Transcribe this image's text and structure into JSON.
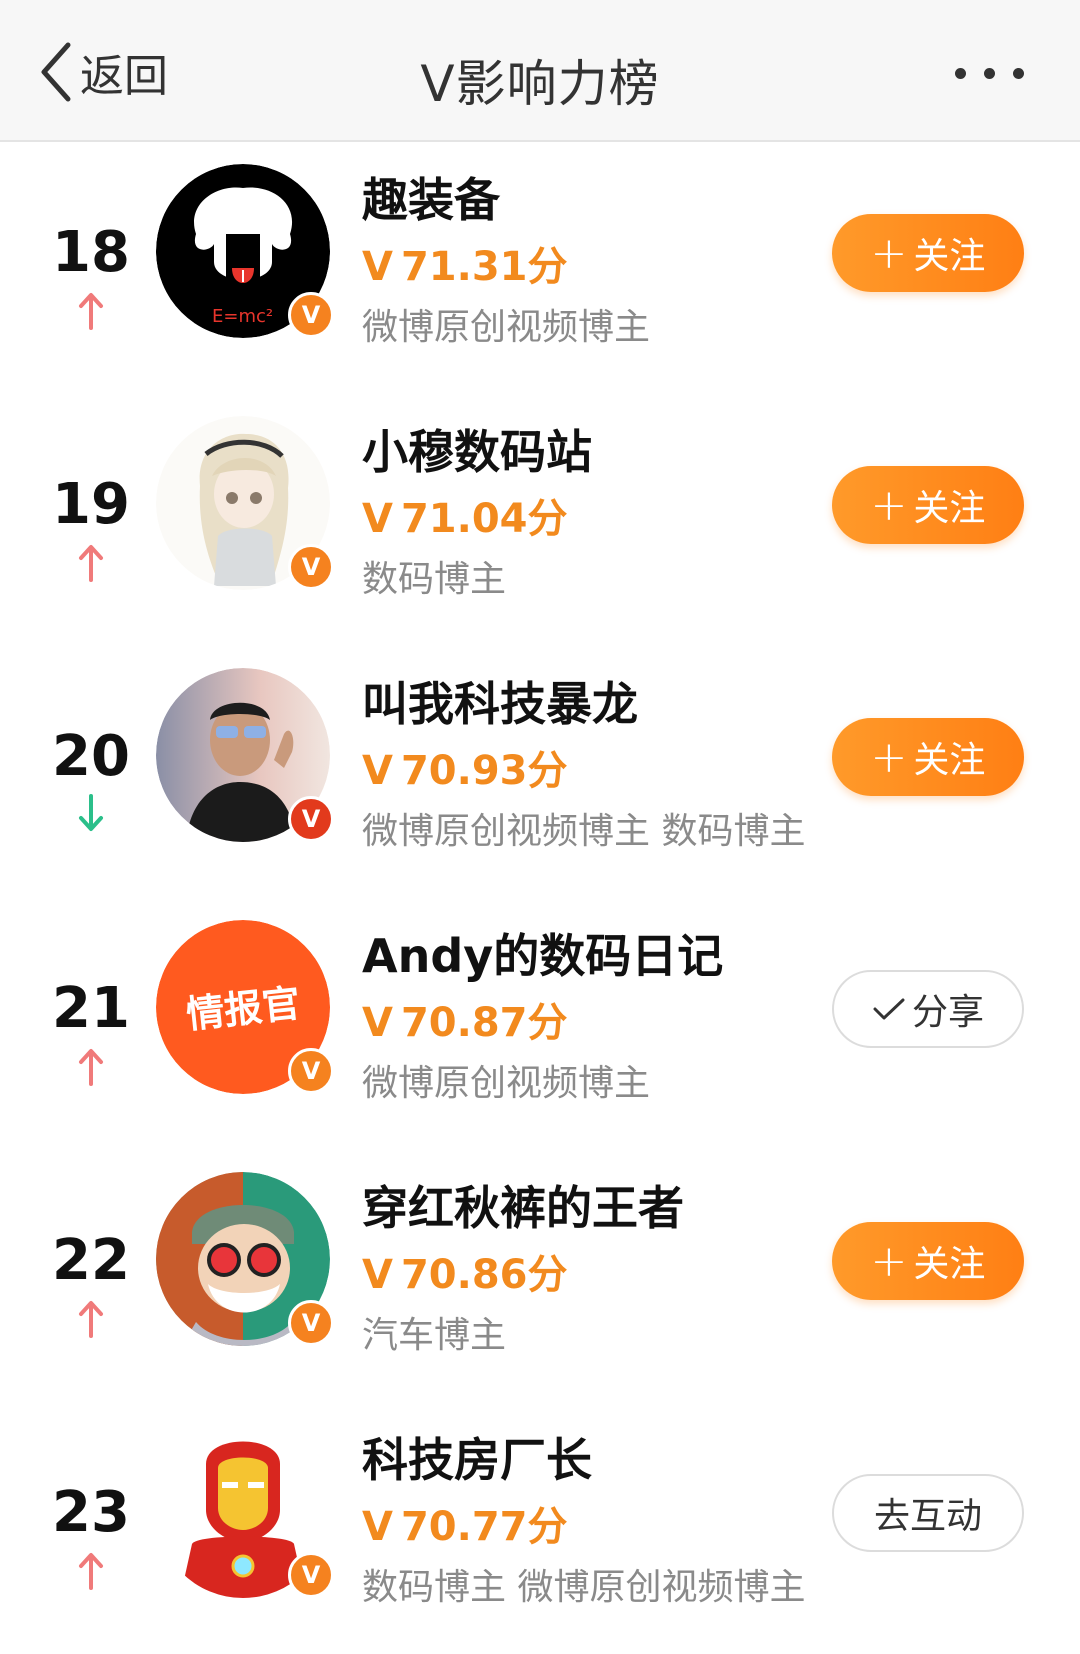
{
  "header": {
    "back_label": "返回",
    "title": "V影响力榜"
  },
  "entries": [
    {
      "rank": "18",
      "trend": "up",
      "name": "趣装备",
      "score": "71.31分",
      "category": "微博原创视频博主",
      "button": {
        "type": "follow",
        "label": "关注"
      }
    },
    {
      "rank": "19",
      "trend": "up",
      "name": "小穆数码站",
      "score": "71.04分",
      "category": "数码博主",
      "button": {
        "type": "follow",
        "label": "关注"
      }
    },
    {
      "rank": "20",
      "trend": "down",
      "name": "叫我科技暴龙",
      "score": "70.93分",
      "category": "微博原创视频博主 数码博主",
      "button": {
        "type": "follow",
        "label": "关注"
      }
    },
    {
      "rank": "21",
      "trend": "up",
      "name": "Andy的数码日记",
      "score": "70.87分",
      "category": "微博原创视频博主",
      "button": {
        "type": "shared",
        "label": "分享"
      }
    },
    {
      "rank": "22",
      "trend": "up",
      "name": "穿红秋裤的王者",
      "score": "70.86分",
      "category": "汽车博主",
      "button": {
        "type": "follow",
        "label": "关注"
      }
    },
    {
      "rank": "23",
      "trend": "up",
      "name": "科技房厂长",
      "score": "70.77分",
      "category": "数码博主 微博原创视频博主",
      "button": {
        "type": "interact",
        "label": "去互动"
      }
    }
  ],
  "avatars": {
    "a18_text": "E=mc²",
    "a21_text": "情报官"
  },
  "badge_letter": "V",
  "score_prefix": "V",
  "colors": {
    "accent": "#f28a1e",
    "up": "#f07a7a",
    "down": "#2bbf8a"
  }
}
